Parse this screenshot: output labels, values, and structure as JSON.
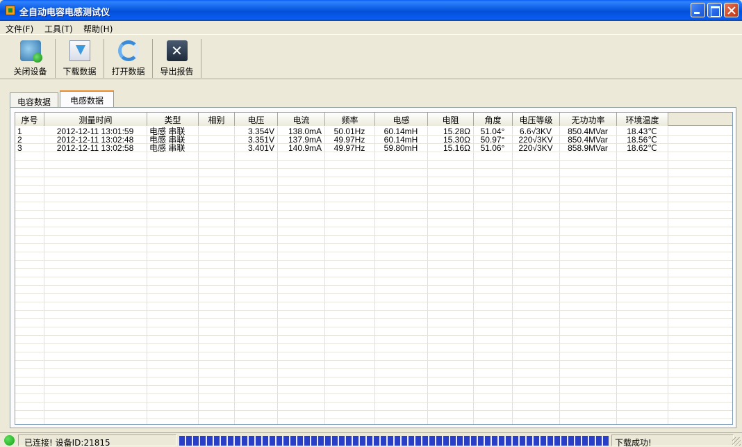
{
  "window": {
    "title": "全自动电容电感测试仪"
  },
  "menu": [
    {
      "label": "文件(F)"
    },
    {
      "label": "工具(T)"
    },
    {
      "label": "帮助(H)"
    }
  ],
  "toolbar": [
    {
      "label": "关闭设备",
      "icon": "disconnect-device-icon"
    },
    {
      "label": "下载数据",
      "icon": "download-icon"
    },
    {
      "label": "打开数据",
      "icon": "open-data-icon"
    },
    {
      "label": "导出报告",
      "icon": "export-report-icon"
    }
  ],
  "tabs": [
    {
      "label": "电容数据",
      "active": false
    },
    {
      "label": "电感数据",
      "active": true
    }
  ],
  "table": {
    "columns": [
      "序号",
      "测量时间",
      "类型",
      "相别",
      "电压",
      "电流",
      "频率",
      "电感",
      "电阻",
      "角度",
      "电压等级",
      "无功功率",
      "环境温度"
    ],
    "rows": [
      [
        "1",
        "2012-12-11 13:01:59",
        "电感 串联",
        "",
        "3.354V",
        "138.0mA",
        "50.01Hz",
        "60.14mH",
        "15.28Ω",
        "51.04°",
        "6.6√3KV",
        "850.4MVar",
        "18.43℃"
      ],
      [
        "2",
        "2012-12-11 13:02:48",
        "电感 串联",
        "",
        "3.351V",
        "137.9mA",
        "49.97Hz",
        "60.14mH",
        "15.30Ω",
        "50.97°",
        "220√3KV",
        "850.4MVar",
        "18.56℃"
      ],
      [
        "3",
        "2012-12-11 13:02:58",
        "电感 串联",
        "",
        "3.401V",
        "140.9mA",
        "49.97Hz",
        "59.80mH",
        "15.16Ω",
        "51.06°",
        "220√3KV",
        "858.9MVar",
        "18.62℃"
      ]
    ]
  },
  "status": {
    "connection": "已连接! 设备ID:21815",
    "progress": 1.0,
    "message": "下载成功!",
    "connected_color": "#14a014",
    "progress_color": "#2a3fc8"
  }
}
